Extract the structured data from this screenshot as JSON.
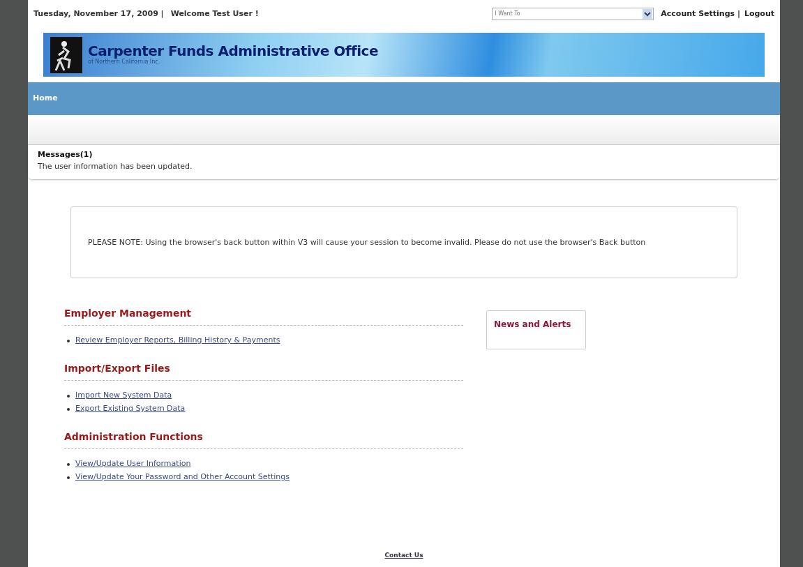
{
  "header": {
    "date": "Tuesday, November 17, 2009 |",
    "welcome": "Welcome Test User !",
    "dropdown": {
      "value": "I Want To"
    },
    "links": [
      "Account Settings |",
      "Logout"
    ]
  },
  "banner": {
    "title": "Carpenter Funds Administrative Office",
    "subtitle": "of Northern California Inc."
  },
  "nav": {
    "items": [
      {
        "label": "Home",
        "selected": true
      }
    ]
  },
  "messages": {
    "title": "Messages(1)",
    "items": [
      "The user information has been updated."
    ]
  },
  "notice": "PLEASE NOTE: Using the browser's back button within V3 will cause your session to become invalid. Please do not use the browser's Back button",
  "sections": [
    {
      "title": "Employer Management",
      "links": [
        "Review Employer Reports, Billing History & Payments"
      ]
    },
    {
      "title": "Import/Export Files",
      "links": [
        "Import New System Data",
        "Export Existing System Data"
      ]
    },
    {
      "title": "Administration Functions",
      "links": [
        "View/Update User Information",
        "View/Update Your Password and Other Account Settings"
      ]
    }
  ],
  "news": {
    "title": "News and Alerts"
  },
  "footer": {
    "link": "Contact Us"
  }
}
